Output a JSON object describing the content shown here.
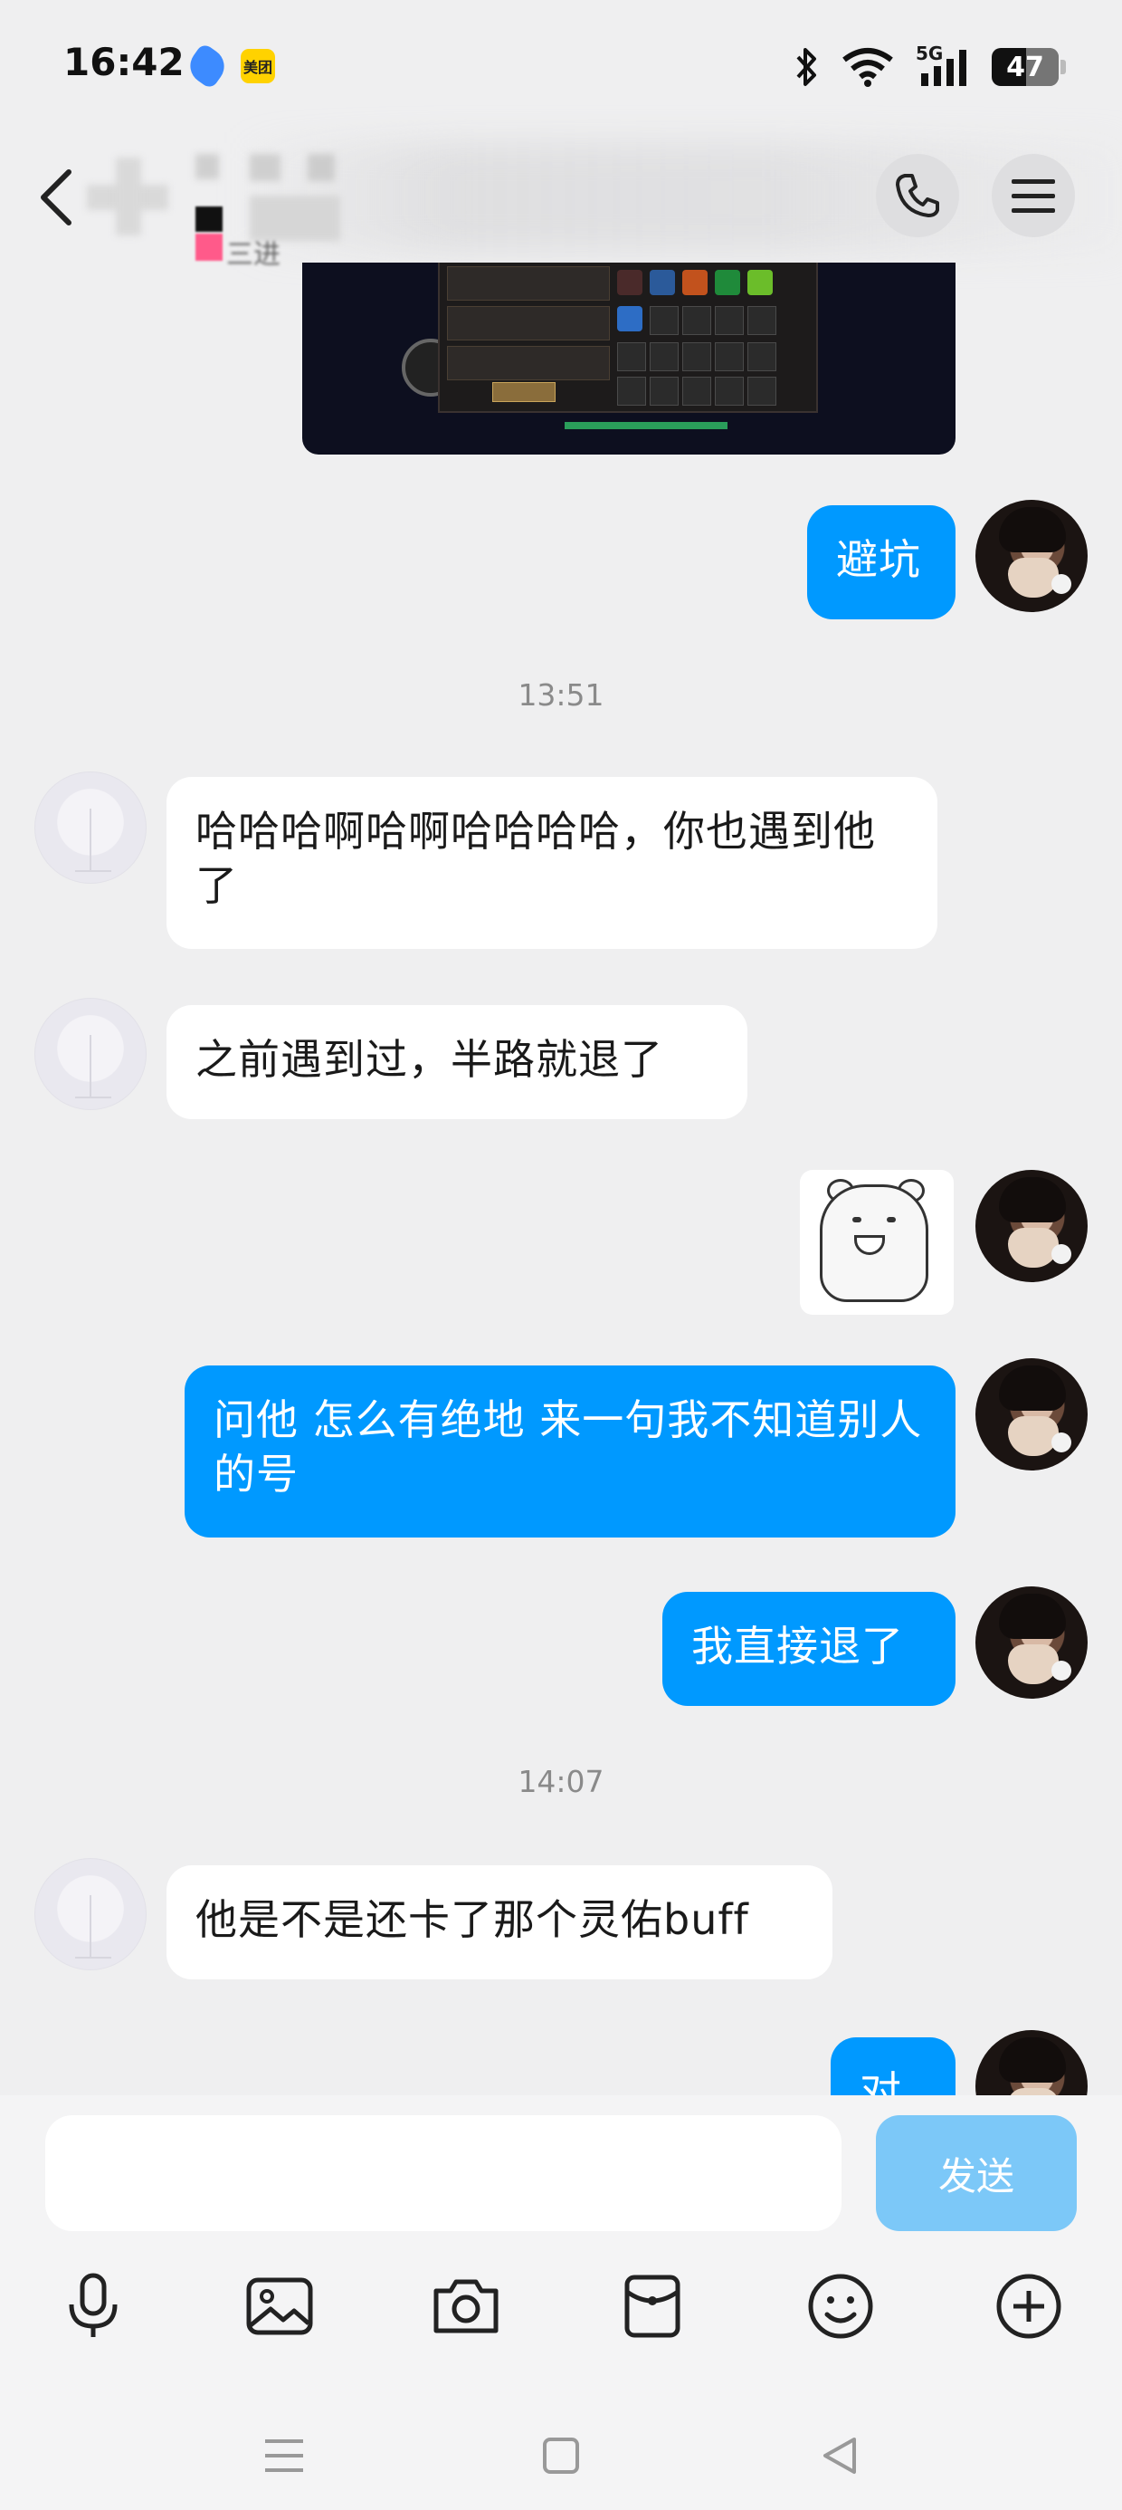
{
  "status_bar": {
    "time": "16:42",
    "app_badge": "美团",
    "network": "5G",
    "battery": "47",
    "icons": [
      "bluetooth-icon",
      "wifi-icon",
      "signal-icon",
      "battery-icon"
    ]
  },
  "header": {
    "contact_name_blurred": "三进",
    "icons": [
      "back-icon",
      "phone-icon",
      "menu-icon"
    ]
  },
  "messages": {
    "ts1": "13:51",
    "ts2": "14:07",
    "m_self_1": "避坑",
    "m_other_1": "哈哈哈啊哈啊哈哈哈哈，你也遇到他了",
    "m_other_2": "之前遇到过，半路就退了",
    "m_self_2": "问他 怎么有绝地  来一句我不知道别人的号",
    "m_self_3": "我直接退了",
    "m_other_3": "他是不是还卡了那个灵佑buff",
    "m_self_4": "对"
  },
  "composer": {
    "input_value": "",
    "send_label": "发送",
    "tools": [
      "microphone-icon",
      "image-icon",
      "camera-icon",
      "red-packet-icon",
      "emoji-icon",
      "plus-icon"
    ]
  },
  "colors": {
    "self_bubble": "#0099ff",
    "other_bubble": "#ffffff",
    "background": "#efeff0",
    "send_disabled": "#7cc8f8"
  }
}
